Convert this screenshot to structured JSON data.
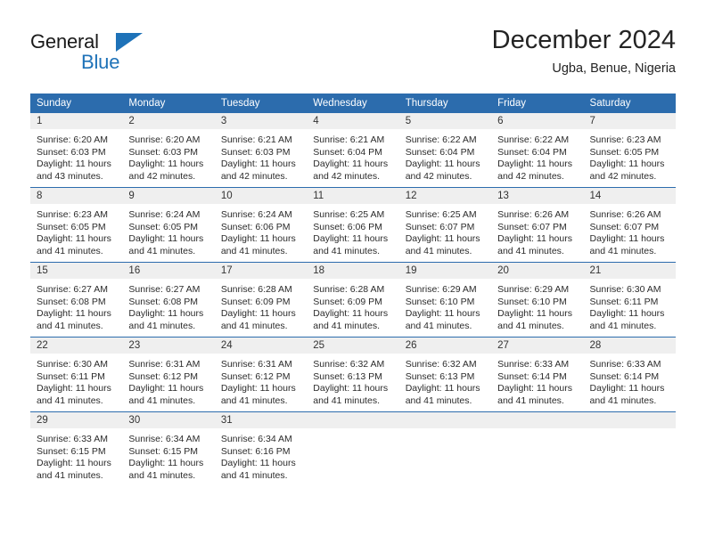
{
  "brand": {
    "name_top": "General",
    "name_bottom": "Blue",
    "accent_color": "#1e72b8"
  },
  "header": {
    "title": "December 2024",
    "subtitle": "Ugba, Benue, Nigeria"
  },
  "calendar": {
    "header_color": "#2c6cad",
    "daynum_band_color": "#efefef",
    "weekday_names": [
      "Sunday",
      "Monday",
      "Tuesday",
      "Wednesday",
      "Thursday",
      "Friday",
      "Saturday"
    ],
    "weeks": [
      [
        {
          "day": "1",
          "sunrise": "Sunrise: 6:20 AM",
          "sunset": "Sunset: 6:03 PM",
          "daylight_line1": "Daylight: 11 hours",
          "daylight_line2": "and 43 minutes."
        },
        {
          "day": "2",
          "sunrise": "Sunrise: 6:20 AM",
          "sunset": "Sunset: 6:03 PM",
          "daylight_line1": "Daylight: 11 hours",
          "daylight_line2": "and 42 minutes."
        },
        {
          "day": "3",
          "sunrise": "Sunrise: 6:21 AM",
          "sunset": "Sunset: 6:03 PM",
          "daylight_line1": "Daylight: 11 hours",
          "daylight_line2": "and 42 minutes."
        },
        {
          "day": "4",
          "sunrise": "Sunrise: 6:21 AM",
          "sunset": "Sunset: 6:04 PM",
          "daylight_line1": "Daylight: 11 hours",
          "daylight_line2": "and 42 minutes."
        },
        {
          "day": "5",
          "sunrise": "Sunrise: 6:22 AM",
          "sunset": "Sunset: 6:04 PM",
          "daylight_line1": "Daylight: 11 hours",
          "daylight_line2": "and 42 minutes."
        },
        {
          "day": "6",
          "sunrise": "Sunrise: 6:22 AM",
          "sunset": "Sunset: 6:04 PM",
          "daylight_line1": "Daylight: 11 hours",
          "daylight_line2": "and 42 minutes."
        },
        {
          "day": "7",
          "sunrise": "Sunrise: 6:23 AM",
          "sunset": "Sunset: 6:05 PM",
          "daylight_line1": "Daylight: 11 hours",
          "daylight_line2": "and 42 minutes."
        }
      ],
      [
        {
          "day": "8",
          "sunrise": "Sunrise: 6:23 AM",
          "sunset": "Sunset: 6:05 PM",
          "daylight_line1": "Daylight: 11 hours",
          "daylight_line2": "and 41 minutes."
        },
        {
          "day": "9",
          "sunrise": "Sunrise: 6:24 AM",
          "sunset": "Sunset: 6:05 PM",
          "daylight_line1": "Daylight: 11 hours",
          "daylight_line2": "and 41 minutes."
        },
        {
          "day": "10",
          "sunrise": "Sunrise: 6:24 AM",
          "sunset": "Sunset: 6:06 PM",
          "daylight_line1": "Daylight: 11 hours",
          "daylight_line2": "and 41 minutes."
        },
        {
          "day": "11",
          "sunrise": "Sunrise: 6:25 AM",
          "sunset": "Sunset: 6:06 PM",
          "daylight_line1": "Daylight: 11 hours",
          "daylight_line2": "and 41 minutes."
        },
        {
          "day": "12",
          "sunrise": "Sunrise: 6:25 AM",
          "sunset": "Sunset: 6:07 PM",
          "daylight_line1": "Daylight: 11 hours",
          "daylight_line2": "and 41 minutes."
        },
        {
          "day": "13",
          "sunrise": "Sunrise: 6:26 AM",
          "sunset": "Sunset: 6:07 PM",
          "daylight_line1": "Daylight: 11 hours",
          "daylight_line2": "and 41 minutes."
        },
        {
          "day": "14",
          "sunrise": "Sunrise: 6:26 AM",
          "sunset": "Sunset: 6:07 PM",
          "daylight_line1": "Daylight: 11 hours",
          "daylight_line2": "and 41 minutes."
        }
      ],
      [
        {
          "day": "15",
          "sunrise": "Sunrise: 6:27 AM",
          "sunset": "Sunset: 6:08 PM",
          "daylight_line1": "Daylight: 11 hours",
          "daylight_line2": "and 41 minutes."
        },
        {
          "day": "16",
          "sunrise": "Sunrise: 6:27 AM",
          "sunset": "Sunset: 6:08 PM",
          "daylight_line1": "Daylight: 11 hours",
          "daylight_line2": "and 41 minutes."
        },
        {
          "day": "17",
          "sunrise": "Sunrise: 6:28 AM",
          "sunset": "Sunset: 6:09 PM",
          "daylight_line1": "Daylight: 11 hours",
          "daylight_line2": "and 41 minutes."
        },
        {
          "day": "18",
          "sunrise": "Sunrise: 6:28 AM",
          "sunset": "Sunset: 6:09 PM",
          "daylight_line1": "Daylight: 11 hours",
          "daylight_line2": "and 41 minutes."
        },
        {
          "day": "19",
          "sunrise": "Sunrise: 6:29 AM",
          "sunset": "Sunset: 6:10 PM",
          "daylight_line1": "Daylight: 11 hours",
          "daylight_line2": "and 41 minutes."
        },
        {
          "day": "20",
          "sunrise": "Sunrise: 6:29 AM",
          "sunset": "Sunset: 6:10 PM",
          "daylight_line1": "Daylight: 11 hours",
          "daylight_line2": "and 41 minutes."
        },
        {
          "day": "21",
          "sunrise": "Sunrise: 6:30 AM",
          "sunset": "Sunset: 6:11 PM",
          "daylight_line1": "Daylight: 11 hours",
          "daylight_line2": "and 41 minutes."
        }
      ],
      [
        {
          "day": "22",
          "sunrise": "Sunrise: 6:30 AM",
          "sunset": "Sunset: 6:11 PM",
          "daylight_line1": "Daylight: 11 hours",
          "daylight_line2": "and 41 minutes."
        },
        {
          "day": "23",
          "sunrise": "Sunrise: 6:31 AM",
          "sunset": "Sunset: 6:12 PM",
          "daylight_line1": "Daylight: 11 hours",
          "daylight_line2": "and 41 minutes."
        },
        {
          "day": "24",
          "sunrise": "Sunrise: 6:31 AM",
          "sunset": "Sunset: 6:12 PM",
          "daylight_line1": "Daylight: 11 hours",
          "daylight_line2": "and 41 minutes."
        },
        {
          "day": "25",
          "sunrise": "Sunrise: 6:32 AM",
          "sunset": "Sunset: 6:13 PM",
          "daylight_line1": "Daylight: 11 hours",
          "daylight_line2": "and 41 minutes."
        },
        {
          "day": "26",
          "sunrise": "Sunrise: 6:32 AM",
          "sunset": "Sunset: 6:13 PM",
          "daylight_line1": "Daylight: 11 hours",
          "daylight_line2": "and 41 minutes."
        },
        {
          "day": "27",
          "sunrise": "Sunrise: 6:33 AM",
          "sunset": "Sunset: 6:14 PM",
          "daylight_line1": "Daylight: 11 hours",
          "daylight_line2": "and 41 minutes."
        },
        {
          "day": "28",
          "sunrise": "Sunrise: 6:33 AM",
          "sunset": "Sunset: 6:14 PM",
          "daylight_line1": "Daylight: 11 hours",
          "daylight_line2": "and 41 minutes."
        }
      ],
      [
        {
          "day": "29",
          "sunrise": "Sunrise: 6:33 AM",
          "sunset": "Sunset: 6:15 PM",
          "daylight_line1": "Daylight: 11 hours",
          "daylight_line2": "and 41 minutes."
        },
        {
          "day": "30",
          "sunrise": "Sunrise: 6:34 AM",
          "sunset": "Sunset: 6:15 PM",
          "daylight_line1": "Daylight: 11 hours",
          "daylight_line2": "and 41 minutes."
        },
        {
          "day": "31",
          "sunrise": "Sunrise: 6:34 AM",
          "sunset": "Sunset: 6:16 PM",
          "daylight_line1": "Daylight: 11 hours",
          "daylight_line2": "and 41 minutes."
        },
        {
          "day": "",
          "sunrise": "",
          "sunset": "",
          "daylight_line1": "",
          "daylight_line2": ""
        },
        {
          "day": "",
          "sunrise": "",
          "sunset": "",
          "daylight_line1": "",
          "daylight_line2": ""
        },
        {
          "day": "",
          "sunrise": "",
          "sunset": "",
          "daylight_line1": "",
          "daylight_line2": ""
        },
        {
          "day": "",
          "sunrise": "",
          "sunset": "",
          "daylight_line1": "",
          "daylight_line2": ""
        }
      ]
    ]
  }
}
